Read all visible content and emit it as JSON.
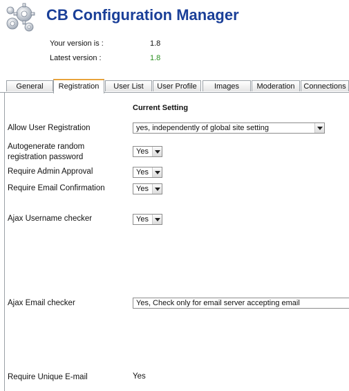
{
  "header": {
    "title": "CB Configuration Manager",
    "logo_icon": "gears-icon",
    "your_version_label": "Your version is :",
    "your_version_value": "1.8",
    "latest_version_label": "Latest version :",
    "latest_version_value": "1.8",
    "latest_version_color": "#2a8f1f",
    "title_color": "#1a3f98"
  },
  "tabs": [
    {
      "label": "General"
    },
    {
      "label": "Registration",
      "active": true
    },
    {
      "label": "User List"
    },
    {
      "label": "User Profile"
    },
    {
      "label": "Images"
    },
    {
      "label": "Moderation"
    },
    {
      "label": "Connections"
    }
  ],
  "registration": {
    "column_header": "Current Setting",
    "allow_registration": {
      "label": "Allow User Registration",
      "value": "yes, independently of global site setting"
    },
    "autogenerate_password": {
      "label": "Autogenerate random registration password",
      "value": "Yes"
    },
    "admin_approval": {
      "label": "Require Admin Approval",
      "value": "Yes"
    },
    "email_confirmation": {
      "label": "Require Email Confirmation",
      "value": "Yes"
    },
    "ajax_username": {
      "label": "Ajax Username checker",
      "value": "Yes"
    },
    "ajax_email": {
      "label": "Ajax Email checker",
      "value": "Yes, Check only for email server accepting email"
    },
    "unique_email": {
      "label": "Require Unique E-mail",
      "value": "Yes"
    }
  }
}
